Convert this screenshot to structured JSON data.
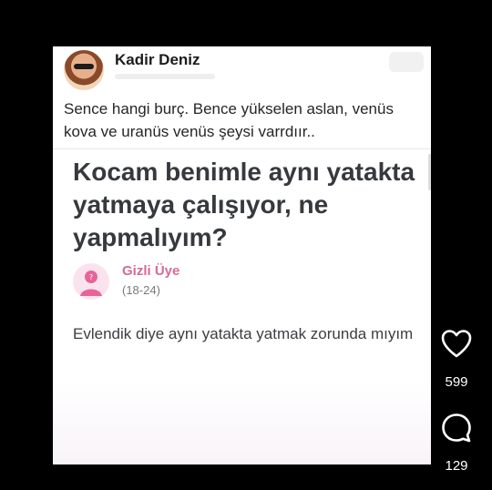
{
  "post": {
    "author": "Kadir Deniz",
    "caption": "Sence hangi burç. Bence yükselen aslan, venüs kova ve uranüs venüs şeysi varrdıır.."
  },
  "question": {
    "title": "Kocam benimle aynı yatakta yatmaya çalışıyor, ne yapmalıyım?",
    "asker_name": "Gizli Üye",
    "asker_age": "(18-24)",
    "body": "Evlendik diye aynı yatakta yatmak zorunda mıyım"
  },
  "actions": {
    "like_count": "599",
    "comment_count": "129",
    "like_icon": "heart-icon",
    "comment_icon": "comment-bubble-icon"
  },
  "colors": {
    "asker_accent": "#d56b96",
    "background": "#000000"
  }
}
